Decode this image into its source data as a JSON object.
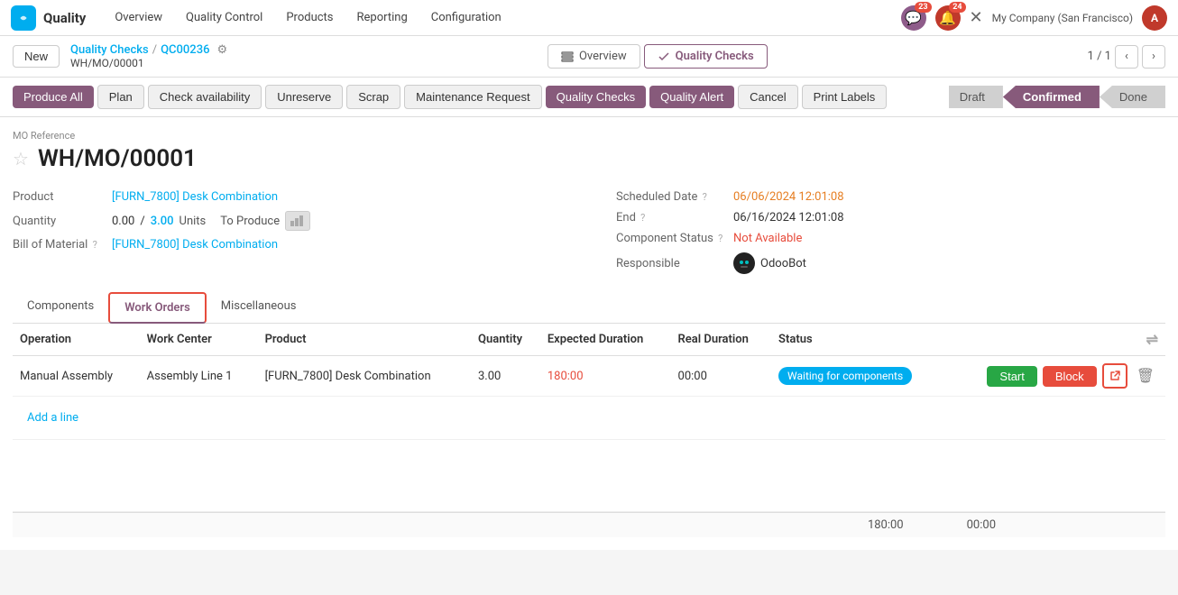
{
  "topnav": {
    "brand": "Quality",
    "items": [
      "Overview",
      "Quality Control",
      "Products",
      "Reporting",
      "Configuration"
    ],
    "active_item": "Quality Control",
    "badge_activity": "23",
    "badge_message": "24",
    "company": "My Company (San Francisco)",
    "avatar_initials": "A"
  },
  "breadcrumb": {
    "new_label": "New",
    "parent_link": "Quality Checks",
    "separator": "/",
    "current_id": "QC00236",
    "sub_label": "WH/MO/00001"
  },
  "center_tabs": {
    "overview_label": "Overview",
    "quality_checks_label": "Quality Checks"
  },
  "pagination": {
    "current": "1 / 1"
  },
  "action_bar": {
    "produce_all": "Produce All",
    "plan": "Plan",
    "check_availability": "Check availability",
    "unreserve": "Unreserve",
    "scrap": "Scrap",
    "maintenance_request": "Maintenance Request",
    "quality_checks": "Quality Checks",
    "quality_alert": "Quality Alert",
    "cancel": "Cancel",
    "print_labels": "Print Labels"
  },
  "status_pipeline": {
    "draft": "Draft",
    "confirmed": "Confirmed",
    "done": "Done"
  },
  "form": {
    "mo_reference_label": "MO Reference",
    "mo_id": "WH/MO/00001",
    "product_label": "Product",
    "product_value": "[FURN_7800] Desk Combination",
    "quantity_label": "Quantity",
    "qty_current": "0.00",
    "qty_separator": "/",
    "qty_target": "3.00",
    "qty_unit": "Units",
    "to_produce_label": "To Produce",
    "bom_label": "Bill of Material",
    "bom_value": "[FURN_7800] Desk Combination",
    "scheduled_date_label": "Scheduled Date",
    "scheduled_date_value": "06/06/2024 12:01:08",
    "end_label": "End",
    "end_value": "06/16/2024 12:01:08",
    "component_status_label": "Component Status",
    "component_status_value": "Not Available",
    "responsible_label": "Responsible",
    "responsible_value": "OdooBot"
  },
  "content_tabs": {
    "components": "Components",
    "work_orders": "Work Orders",
    "miscellaneous": "Miscellaneous"
  },
  "work_orders_table": {
    "headers": [
      "Operation",
      "Work Center",
      "Product",
      "Quantity",
      "Expected Duration",
      "Real Duration",
      "Status",
      ""
    ],
    "rows": [
      {
        "operation": "Manual Assembly",
        "work_center": "Assembly Line 1",
        "product": "[FURN_7800] Desk Combination",
        "quantity": "3.00",
        "expected_duration": "180:00",
        "real_duration": "00:00",
        "status": "Waiting for components"
      }
    ],
    "add_line": "Add a line"
  },
  "footer": {
    "total_expected": "180:00",
    "total_real": "00:00"
  }
}
